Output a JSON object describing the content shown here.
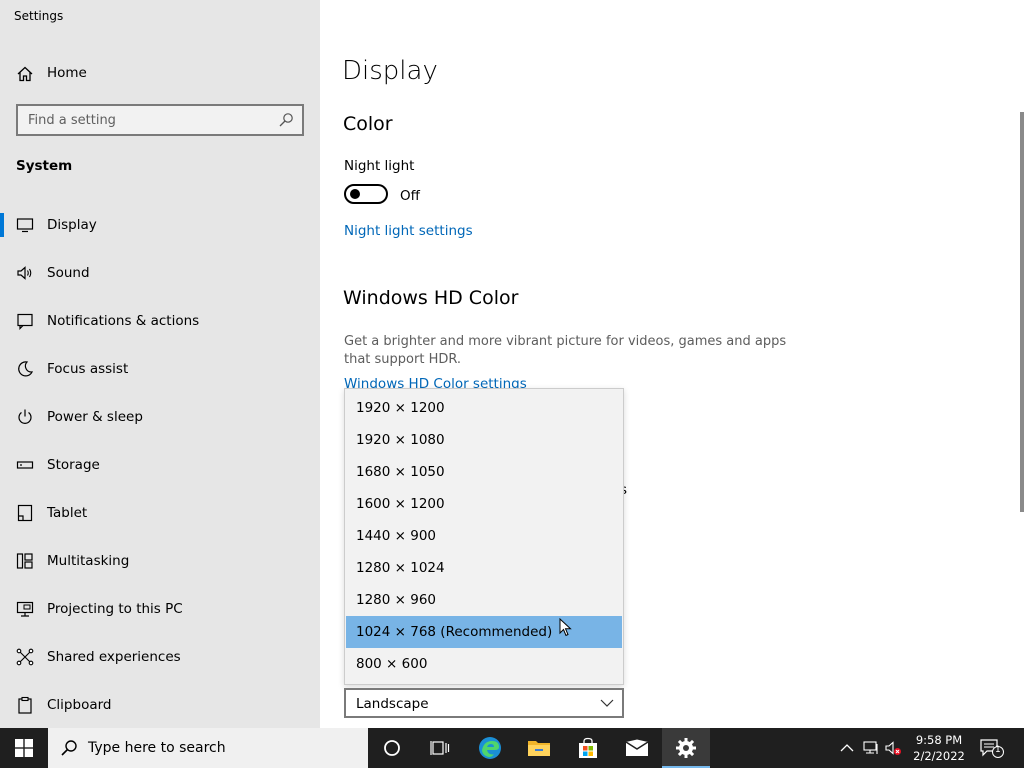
{
  "app": {
    "title": "Settings"
  },
  "sidebar": {
    "home_label": "Home",
    "search_placeholder": "Find a setting",
    "section_title": "System",
    "items": [
      {
        "label": "Display",
        "icon": "monitor-icon",
        "selected": true
      },
      {
        "label": "Sound",
        "icon": "speaker-icon",
        "selected": false
      },
      {
        "label": "Notifications & actions",
        "icon": "notification-icon",
        "selected": false
      },
      {
        "label": "Focus assist",
        "icon": "moon-icon",
        "selected": false
      },
      {
        "label": "Power & sleep",
        "icon": "power-icon",
        "selected": false
      },
      {
        "label": "Storage",
        "icon": "storage-icon",
        "selected": false
      },
      {
        "label": "Tablet",
        "icon": "tablet-icon",
        "selected": false
      },
      {
        "label": "Multitasking",
        "icon": "multitasking-icon",
        "selected": false
      },
      {
        "label": "Projecting to this PC",
        "icon": "projector-icon",
        "selected": false
      },
      {
        "label": "Shared experiences",
        "icon": "share-icon",
        "selected": false
      },
      {
        "label": "Clipboard",
        "icon": "clipboard-icon",
        "selected": false
      }
    ]
  },
  "main": {
    "page_title": "Display",
    "color_heading": "Color",
    "night_light_label": "Night light",
    "night_light_state": "Off",
    "night_light_link": "Night light settings",
    "hd_heading": "Windows HD Color",
    "hd_desc": "Get a brighter and more vibrant picture for videos, games and apps that support HDR.",
    "hd_link": "Windows HD Color settings",
    "hidden_fragment": "s"
  },
  "resolution_dropdown": {
    "options": [
      "1920 × 1200",
      "1920 × 1080",
      "1680 × 1050",
      "1600 × 1200",
      "1440 × 900",
      "1280 × 1024",
      "1280 × 960",
      "1024 × 768 (Recommended)",
      "800 × 600"
    ],
    "highlighted_index": 7
  },
  "orientation": {
    "value": "Landscape"
  },
  "taskbar": {
    "search_placeholder": "Type here to search",
    "time": "9:58 PM",
    "date": "2/2/2022",
    "notification_count": "1"
  },
  "colors": {
    "accent": "#0078d7",
    "link": "#0067b8",
    "highlight": "#78b4e6",
    "sidebar_bg": "#e6e6e6",
    "taskbar_bg": "#1f1f1f"
  }
}
